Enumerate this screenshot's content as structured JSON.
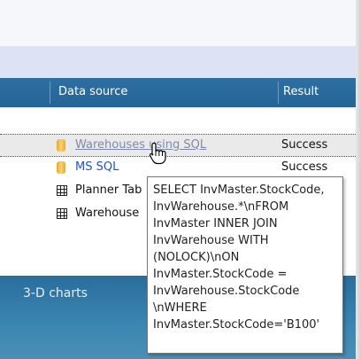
{
  "columns": {
    "data_source": "Data source",
    "result": "Result"
  },
  "rows": [
    {
      "icon": "database-icon",
      "label": "Warehouses using SQL",
      "result": "Success"
    },
    {
      "icon": "database-icon",
      "label": "MS SQL",
      "result": "Success"
    },
    {
      "icon": "table-icon",
      "label": "Planner Tab",
      "result": ""
    },
    {
      "icon": "table-icon",
      "label": "Warehouse",
      "result": ""
    }
  ],
  "tooltip": {
    "text": "SELECT InvMaster.StockCode, InvWarehouse.*\\nFROM InvMaster INNER JOIN InvWarehouse WITH (NOLOCK)\\nON InvMaster.StockCode = InvWarehouse.StockCode \\nWHERE InvMaster.StockCode='B100'"
  },
  "panel": {
    "label": "3-D charts"
  },
  "colors": {
    "header": "#2a6a9e",
    "link": "#1a56c9",
    "panel": "#3780ad"
  }
}
